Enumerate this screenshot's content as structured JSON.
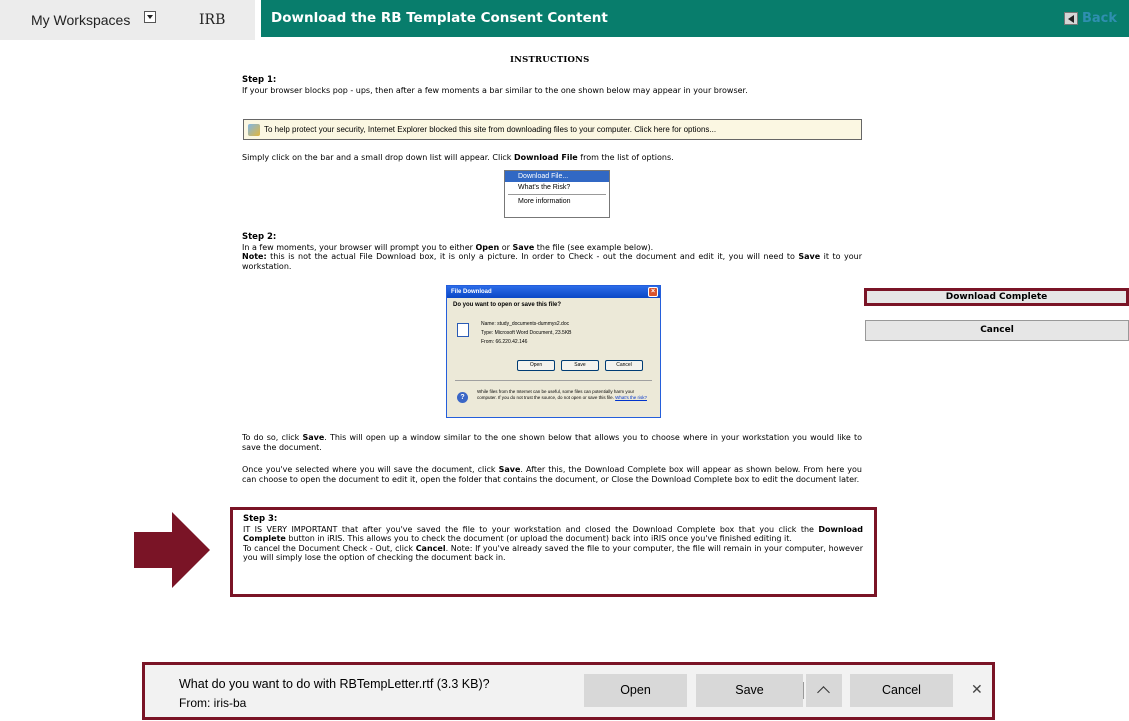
{
  "nav": {
    "workspaces_label": "My Workspaces",
    "irb_label": "IRB"
  },
  "header": {
    "title": "Download the RB Template Consent Content",
    "back_label": "Back"
  },
  "instructions": {
    "heading": "INSTRUCTIONS",
    "step1_title": "Step 1:",
    "step1_text": "If your browser blocks pop - ups, then after a few moments a bar similar to the one shown below may appear in your browser.",
    "ie_bar_text": "To help protect your security, Internet Explorer blocked this site from downloading files to your computer. Click here for options...",
    "click_bar_text_a": "Simply click on the bar and a small drop down list will appear. Click ",
    "click_bar_bold": "Download File",
    "click_bar_text_b": " from the list of options.",
    "dropdown": [
      "Download File...",
      "What's the Risk?",
      "More information"
    ],
    "step2_title": "Step 2:",
    "step2_a": "In a few moments, your browser will prompt you to either ",
    "step2_open": "Open",
    "step2_or": " or ",
    "step2_save": "Save",
    "step2_b": " the file (see example below).",
    "note_label": "Note:",
    "note_a": " this is not the actual File Download box, it is only a picture. In order to Check - out the document and edit it, you will need to ",
    "note_save": "Save",
    "note_b": " it to your workstation.",
    "after1_a": "To do so, click ",
    "after1_save": "Save",
    "after1_b": ". This will open up a window similar to the one shown below that allows you to choose where in your workstation you would like to save the document.",
    "after2_a": "Once you've selected where you will save the document, click ",
    "after2_save": "Save",
    "after2_b": ". After this, the Download Complete box will appear as shown below. From here you can choose to open the document to edit it, open the folder that contains the document, or Close the Download Complete box to edit the document later.",
    "step3_title": "Step 3:",
    "step3_a": "IT IS VERY IMPORTANT that after you've saved the file to your workstation and closed the Download Complete box that you click the ",
    "step3_bold": "Download Complete",
    "step3_b": " button in iRIS. This allows you to check the document (or upload the document) back into iRIS once you've finished editing it.",
    "step3_c": "To cancel the Document Check - Out, click ",
    "step3_cancel": "Cancel",
    "step3_d": ". Note: If you've already saved the file to your computer, the file will remain in your computer, however you will simply lose the option of checking the document back in."
  },
  "file_dialog": {
    "title": "File Download",
    "question": "Do you want to open or save this file?",
    "name_line": "Name:  study_documents-dummys2.doc",
    "type_line": "Type:  Microsoft Word Document, 23.5KB",
    "from_line": "From:  66.220.42.146",
    "open": "Open",
    "save": "Save",
    "cancel": "Cancel",
    "warning": "While files from the Internet can be useful, some files can potentially harm your computer. If you do not trust the source, do not open or save this file.",
    "risk_link": "What's the risk?"
  },
  "actions": {
    "download_complete": "Download Complete",
    "cancel": "Cancel"
  },
  "download_bar": {
    "question": "What do you want to do with RBTempLetter.rtf (3.3 KB)?",
    "from": "From: iris-ba",
    "open": "Open",
    "save": "Save",
    "cancel": "Cancel"
  },
  "colors": {
    "header_teal": "#087d6c",
    "highlight_maroon": "#7a1426",
    "back_link": "#2f8fb0"
  }
}
